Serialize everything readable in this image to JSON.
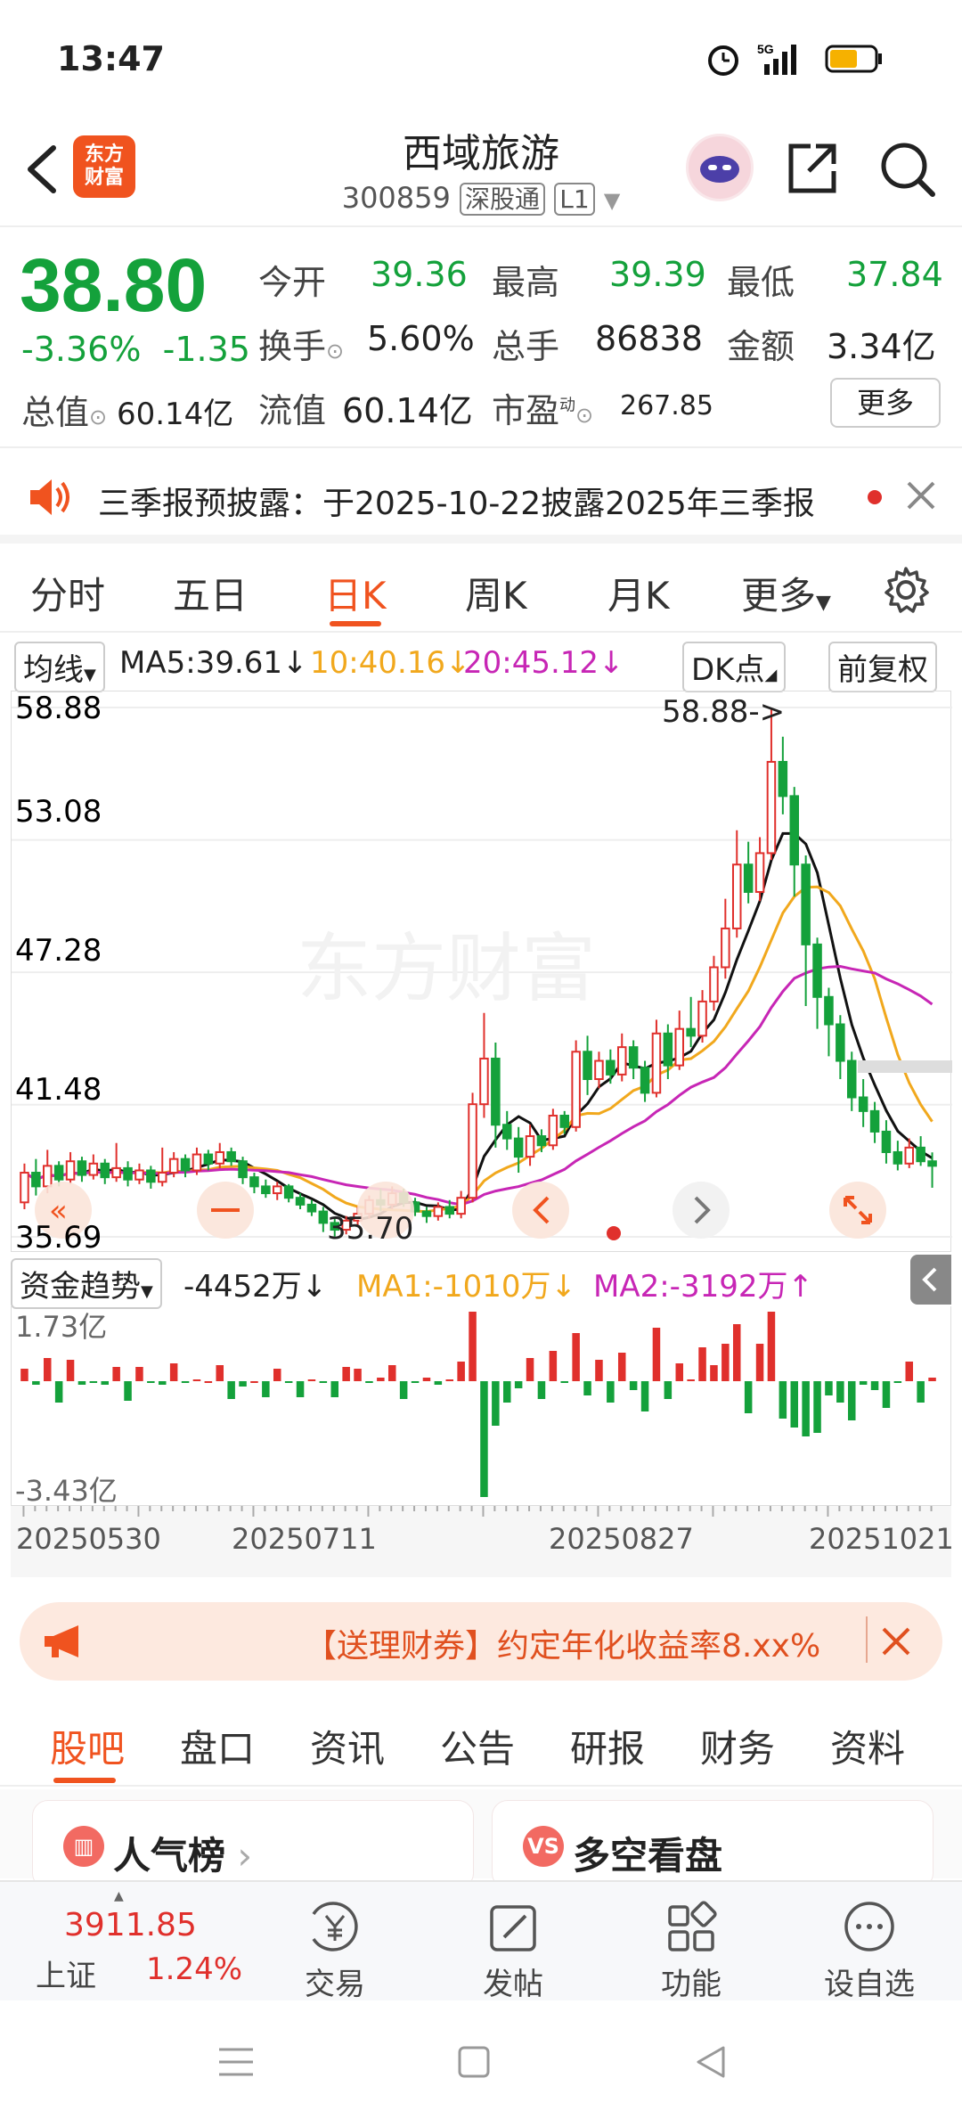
{
  "status_bar": {
    "time": "13:47",
    "network": "5G"
  },
  "header": {
    "logo_text_line1": "东方",
    "logo_text_line2": "财富",
    "stock_name": "西域旅游",
    "stock_code": "300859",
    "tag_connect": "深股通",
    "tag_level": "L1"
  },
  "quote": {
    "price": "38.80",
    "change_pct": "-3.36%",
    "change_amt": "-1.35",
    "fields": [
      {
        "label": "今开",
        "value": "39.36",
        "color": "green"
      },
      {
        "label": "最高",
        "value": "39.39",
        "color": "green"
      },
      {
        "label": "最低",
        "value": "37.84",
        "color": "green"
      },
      {
        "label": "换手",
        "value": "5.60%",
        "color": "normal"
      },
      {
        "label": "总手",
        "value": "86838",
        "color": "normal"
      },
      {
        "label": "金额",
        "value": "3.34亿",
        "color": "normal"
      },
      {
        "label": "流值",
        "value": "60.14亿",
        "color": "normal"
      },
      {
        "label": "市盈",
        "value": "267.85",
        "color": "normal"
      }
    ],
    "market_cap_label": "总值",
    "market_cap_value": "60.14亿",
    "pe_superscript": "动",
    "more_button": "更多"
  },
  "notice": {
    "text": "三季报预披露：于2025-10-22披露2025年三季报"
  },
  "period_tabs": [
    "分时",
    "五日",
    "日K",
    "周K",
    "月K",
    "更多"
  ],
  "active_period": "日K",
  "ma_bar": {
    "selector": "均线",
    "ma5": "MA5:39.61↓",
    "ma10": "10:40.16↓",
    "ma20": "20:45.12↓",
    "dk_button": "DK点",
    "adjust_button": "前复权"
  },
  "chart_data": {
    "type": "candlestick",
    "y_ticks": [
      "58.88",
      "53.08",
      "47.28",
      "41.48",
      "35.69"
    ],
    "ylim": [
      35.69,
      58.88
    ],
    "x_ticks": [
      "20250530",
      "20250711",
      "20250827",
      "20251021"
    ],
    "max_annotation": "58.88->",
    "min_annotation": "35.70",
    "watermark": "东方财富",
    "series": [
      {
        "name": "MA5",
        "color": "#111111"
      },
      {
        "name": "MA10",
        "color": "#f1a81d"
      },
      {
        "name": "MA20",
        "color": "#c726b5"
      }
    ],
    "candles": [
      [
        37.2,
        38.5,
        36.9,
        38.9
      ],
      [
        38.5,
        37.9,
        37.5,
        39.1
      ],
      [
        37.9,
        38.8,
        37.6,
        39.5
      ],
      [
        38.8,
        38.2,
        37.9,
        39.0
      ],
      [
        38.2,
        39.0,
        38.0,
        39.4
      ],
      [
        39.0,
        38.4,
        38.1,
        39.2
      ],
      [
        38.4,
        38.9,
        38.2,
        39.3
      ],
      [
        38.9,
        38.3,
        38.0,
        39.1
      ],
      [
        38.3,
        38.7,
        38.1,
        39.8
      ],
      [
        38.7,
        38.2,
        37.9,
        39.0
      ],
      [
        38.2,
        38.6,
        38.0,
        38.9
      ],
      [
        38.6,
        38.1,
        37.8,
        38.8
      ],
      [
        38.1,
        38.5,
        37.9,
        39.6
      ],
      [
        38.5,
        39.1,
        38.3,
        39.4
      ],
      [
        39.1,
        38.6,
        38.3,
        39.3
      ],
      [
        38.6,
        39.3,
        38.4,
        39.6
      ],
      [
        39.3,
        38.9,
        38.6,
        39.5
      ],
      [
        38.9,
        39.4,
        38.7,
        39.8
      ],
      [
        39.4,
        39.0,
        38.8,
        39.6
      ],
      [
        39.0,
        38.3,
        38.0,
        39.2
      ],
      [
        38.3,
        37.9,
        37.6,
        38.5
      ],
      [
        37.9,
        37.6,
        37.4,
        38.2
      ],
      [
        37.6,
        37.9,
        37.3,
        38.1
      ],
      [
        37.9,
        37.4,
        37.2,
        38.0
      ],
      [
        37.4,
        37.1,
        36.9,
        37.6
      ],
      [
        37.1,
        36.8,
        36.6,
        37.3
      ],
      [
        36.8,
        36.3,
        35.9,
        37.0
      ],
      [
        36.3,
        36.0,
        35.7,
        36.5
      ],
      [
        36.0,
        36.4,
        35.8,
        36.6
      ],
      [
        36.4,
        36.7,
        36.2,
        37.0
      ],
      [
        36.7,
        37.3,
        36.5,
        37.5
      ],
      [
        37.3,
        37.1,
        36.8,
        37.8
      ],
      [
        37.1,
        37.6,
        36.9,
        37.9
      ],
      [
        37.6,
        37.2,
        37.0,
        37.8
      ],
      [
        37.2,
        36.8,
        36.6,
        37.4
      ],
      [
        36.8,
        36.6,
        36.3,
        37.0
      ],
      [
        36.6,
        37.0,
        36.4,
        37.2
      ],
      [
        37.0,
        36.7,
        36.5,
        37.3
      ],
      [
        36.7,
        37.4,
        36.5,
        37.7
      ],
      [
        37.4,
        41.5,
        37.2,
        42.0
      ],
      [
        41.5,
        43.5,
        40.9,
        45.5
      ],
      [
        43.5,
        40.6,
        39.6,
        44.2
      ],
      [
        40.6,
        40.0,
        39.5,
        41.2
      ],
      [
        40.0,
        39.2,
        38.5,
        40.5
      ],
      [
        39.2,
        40.1,
        38.8,
        40.6
      ],
      [
        40.1,
        39.7,
        39.4,
        40.4
      ],
      [
        39.7,
        41.0,
        39.5,
        41.3
      ],
      [
        41.0,
        40.5,
        40.2,
        41.2
      ],
      [
        40.5,
        43.8,
        40.3,
        44.3
      ],
      [
        43.8,
        42.6,
        41.9,
        44.5
      ],
      [
        42.6,
        43.4,
        42.2,
        43.8
      ],
      [
        43.4,
        42.8,
        42.4,
        43.9
      ],
      [
        42.8,
        44.0,
        42.5,
        44.6
      ],
      [
        44.0,
        43.1,
        42.6,
        44.3
      ],
      [
        43.1,
        42.0,
        41.6,
        43.4
      ],
      [
        42.0,
        44.6,
        41.8,
        45.2
      ],
      [
        44.6,
        43.2,
        42.6,
        45.0
      ],
      [
        43.2,
        44.8,
        43.0,
        45.6
      ],
      [
        44.8,
        44.5,
        44.0,
        46.2
      ],
      [
        44.5,
        46.0,
        44.2,
        46.5
      ],
      [
        46.0,
        47.5,
        45.6,
        48.0
      ],
      [
        47.5,
        49.2,
        47.0,
        50.5
      ],
      [
        49.2,
        52.0,
        48.8,
        53.5
      ],
      [
        52.0,
        50.8,
        50.3,
        53.0
      ],
      [
        50.8,
        52.5,
        50.4,
        53.2
      ],
      [
        52.5,
        56.5,
        52.2,
        58.88
      ],
      [
        56.5,
        55.0,
        54.2,
        57.6
      ],
      [
        55.0,
        52.0,
        50.6,
        55.4
      ],
      [
        52.0,
        48.5,
        45.8,
        52.4
      ],
      [
        48.5,
        46.2,
        44.8,
        48.8
      ],
      [
        46.2,
        45.0,
        43.6,
        46.6
      ],
      [
        45.0,
        43.4,
        42.6,
        45.4
      ],
      [
        43.4,
        41.8,
        41.2,
        43.8
      ],
      [
        41.8,
        41.2,
        40.5,
        42.6
      ],
      [
        41.2,
        40.3,
        39.8,
        41.6
      ],
      [
        40.3,
        39.4,
        38.9,
        40.8
      ],
      [
        39.4,
        38.9,
        38.6,
        39.9
      ],
      [
        38.9,
        39.6,
        38.7,
        40.0
      ],
      [
        39.6,
        39.0,
        38.8,
        40.1
      ],
      [
        39.0,
        38.8,
        37.84,
        39.39
      ]
    ]
  },
  "fund_flow": {
    "selector": "资金趋势",
    "value": "-4452万↓",
    "ma1": "MA1:-1010万↓",
    "ma2": "MA2:-3192万↑",
    "y_max": "1.73亿",
    "y_min": "-3.43亿"
  },
  "ad": {
    "text": "【送理财券】约定年化收益率8.xx%"
  },
  "bottom_tabs": [
    "股吧",
    "盘口",
    "资讯",
    "公告",
    "研报",
    "财务",
    "资料"
  ],
  "cards": [
    {
      "title": "人气榜",
      "icon": "bar-chart-icon"
    },
    {
      "title": "多空看盘",
      "icon": "vs-icon"
    }
  ],
  "nav": {
    "index_value": "3911.85",
    "index_name": "上证",
    "index_change": "1.24%",
    "items": [
      "交易",
      "发帖",
      "功能",
      "设自选"
    ]
  }
}
